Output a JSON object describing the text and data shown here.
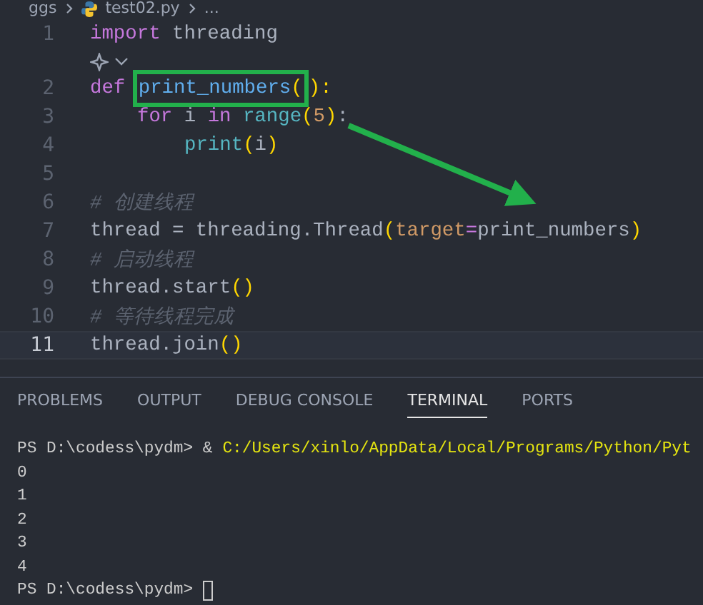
{
  "breadcrumb": [
    "ggs",
    "test02.py",
    "..."
  ],
  "code_lines": [
    {
      "number": "1",
      "current": false,
      "tokens": [
        {
          "kind": "keyword",
          "text": "import"
        },
        {
          "kind": "plain",
          "text": " threading"
        }
      ]
    },
    {
      "kind": "codelens"
    },
    {
      "number": "2",
      "current": false,
      "tokens": [
        {
          "kind": "keyword",
          "text": "def "
        },
        {
          "kind": "function",
          "text": "print_numbers",
          "framed": true
        },
        {
          "kind": "paren",
          "text": "(",
          "framed": true
        },
        {
          "kind": "paren",
          "text": "):"
        }
      ],
      "children": [
        {
          "number": "3",
          "current": false,
          "tokens": [
            {
              "kind": "keyword",
              "text": "for"
            },
            {
              "kind": "plain",
              "text": " i "
            },
            {
              "kind": "keyword",
              "text": "in"
            },
            {
              "kind": "builtin",
              "text": " range"
            },
            {
              "kind": "paren",
              "text": "("
            },
            {
              "kind": "number",
              "text": "5"
            },
            {
              "kind": "paren",
              "text": ")"
            },
            {
              "kind": "plain",
              "text": ":"
            }
          ],
          "children": [
            {
              "number": "4",
              "current": false,
              "tokens": [
                {
                  "kind": "builtin",
                  "text": "print"
                },
                {
                  "kind": "paren",
                  "text": "("
                },
                {
                  "kind": "plain",
                  "text": "i"
                },
                {
                  "kind": "paren",
                  "text": ")"
                }
              ]
            }
          ]
        }
      ]
    },
    {
      "number": "5",
      "current": false
    },
    {
      "number": "6",
      "current": false,
      "tokens": [
        {
          "kind": "comment",
          "text": "# 创建线程"
        }
      ]
    },
    {
      "number": "7",
      "current": false,
      "tokens": [
        {
          "kind": "plain",
          "text": "thread = threading.Thread"
        },
        {
          "kind": "paren",
          "text": "("
        },
        {
          "kind": "param",
          "text": "target"
        },
        {
          "kind": "operator",
          "text": "="
        },
        {
          "kind": "plain",
          "text": "print_numbers"
        },
        {
          "kind": "paren",
          "text": ")"
        }
      ]
    },
    {
      "number": "8",
      "current": false,
      "tokens": [
        {
          "kind": "comment",
          "text": "# 启动线程"
        }
      ]
    },
    {
      "number": "9",
      "current": false,
      "tokens": [
        {
          "kind": "plain",
          "text": "thread.start"
        },
        {
          "kind": "paren",
          "text": "()"
        }
      ]
    },
    {
      "number": "10",
      "current": false,
      "tokens": [
        {
          "kind": "comment",
          "text": "# 等待线程完成"
        }
      ]
    },
    {
      "number": "11",
      "current": true,
      "tokens": [
        {
          "kind": "plain",
          "text": "thread.join"
        },
        {
          "kind": "paren",
          "text": "()"
        }
      ]
    }
  ],
  "panel_tabs": [
    {
      "label": "PROBLEMS",
      "selected": false
    },
    {
      "label": "OUTPUT",
      "selected": false
    },
    {
      "label": "DEBUG CONSOLE",
      "selected": false
    },
    {
      "label": "TERMINAL",
      "selected": true
    },
    {
      "label": "PORTS",
      "selected": false
    }
  ],
  "terminal_lines": [
    {
      "prompt": "PS D:\\codess\\pydm> &",
      "command": "C:/Users/xinlo/AppData/Local/Programs/Python/Pyt"
    },
    {
      "text": "0"
    },
    {
      "text": "1"
    },
    {
      "text": "2"
    },
    {
      "text": "3"
    },
    {
      "text": "4"
    },
    {
      "prompt": "PS D:\\codess\\pydm>",
      "cursor": true
    }
  ]
}
